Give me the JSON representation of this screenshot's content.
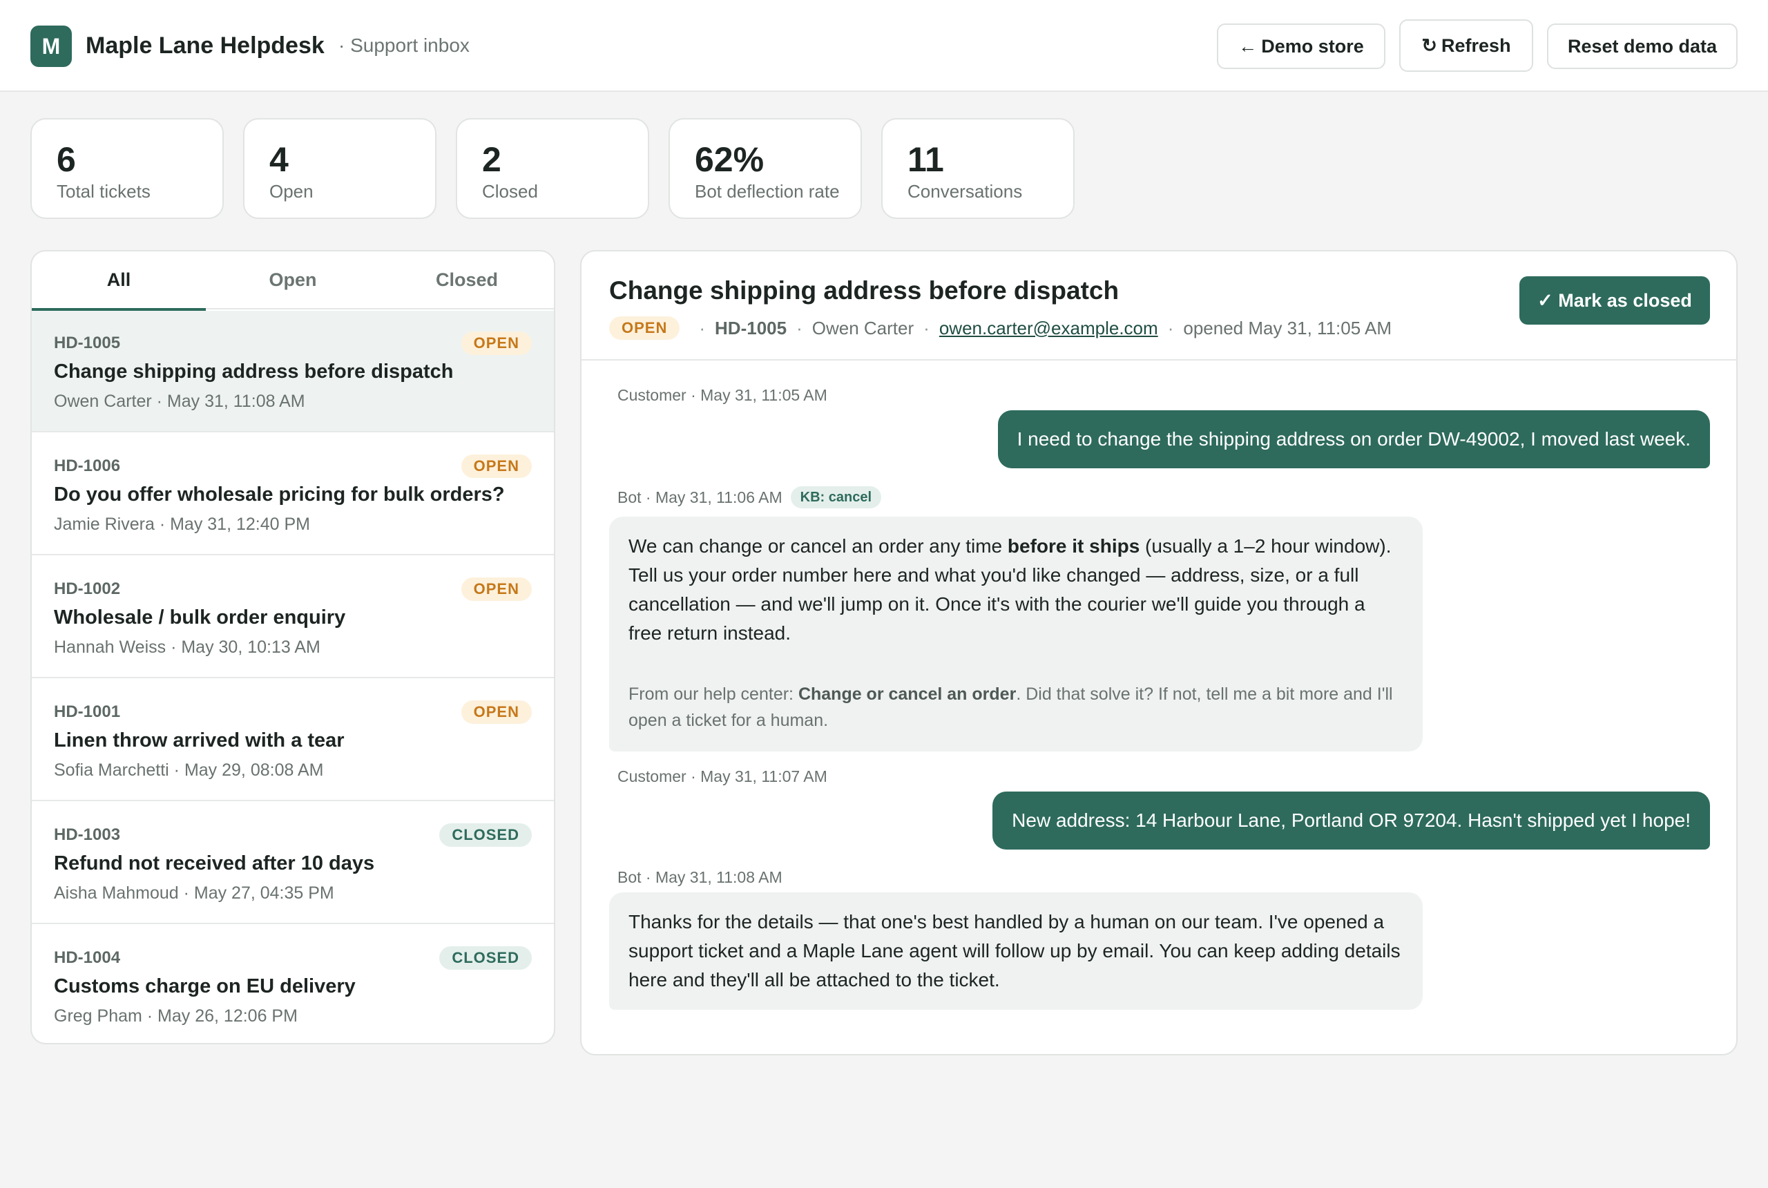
{
  "app": {
    "logo_letter": "M",
    "title": "Maple Lane Helpdesk",
    "subtitle": "· Support inbox"
  },
  "toolbar": {
    "demo_icon": "←",
    "demo_label": "Demo store",
    "refresh_icon": "↻",
    "refresh_label": "Refresh",
    "reset_label": "Reset demo data"
  },
  "stats": [
    {
      "value": "6",
      "label": "Total tickets"
    },
    {
      "value": "4",
      "label": "Open"
    },
    {
      "value": "2",
      "label": "Closed"
    },
    {
      "value": "62%",
      "label": "Bot deflection rate"
    },
    {
      "value": "11",
      "label": "Conversations"
    }
  ],
  "tabs": [
    {
      "label": "All",
      "active": true
    },
    {
      "label": "Open",
      "active": false
    },
    {
      "label": "Closed",
      "active": false
    }
  ],
  "tickets": [
    {
      "id": "HD-1005",
      "status": "OPEN",
      "title": "Change shipping address before dispatch",
      "meta": "Owen Carter · May 31, 11:08 AM",
      "selected": true
    },
    {
      "id": "HD-1006",
      "status": "OPEN",
      "title": "Do you offer wholesale pricing for bulk orders?",
      "meta": "Jamie Rivera · May 31, 12:40 PM",
      "selected": false
    },
    {
      "id": "HD-1002",
      "status": "OPEN",
      "title": "Wholesale / bulk order enquiry",
      "meta": "Hannah Weiss · May 30, 10:13 AM",
      "selected": false
    },
    {
      "id": "HD-1001",
      "status": "OPEN",
      "title": "Linen throw arrived with a tear",
      "meta": "Sofia Marchetti · May 29, 08:08 AM",
      "selected": false
    },
    {
      "id": "HD-1003",
      "status": "CLOSED",
      "title": "Refund not received after 10 days",
      "meta": "Aisha Mahmoud · May 27, 04:35 PM",
      "selected": false
    },
    {
      "id": "HD-1004",
      "status": "CLOSED",
      "title": "Customs charge on EU delivery",
      "meta": "Greg Pham · May 26, 12:06 PM",
      "selected": false
    }
  ],
  "detail": {
    "title": "Change shipping address before dispatch",
    "status": "OPEN",
    "id": "HD-1005",
    "customer": "Owen Carter",
    "email": "owen.carter@example.com",
    "opened": "opened May 31, 11:05 AM",
    "sep": "·",
    "close_button": "✓ Mark as closed",
    "messages": [
      {
        "meta": "Customer · May 31, 11:05 AM",
        "text": "I need to change the shipping address on order DW-49002, I moved last week."
      },
      {
        "meta": "Bot · May 31, 11:06 AM",
        "kb": "KB: cancel",
        "text_before": "We can change or cancel an order any time ",
        "text_bold": "before it ships",
        "text_after": " (usually a 1–2 hour window). Tell us your order number here and what you'd like changed — address, size, or a full cancellation — and we'll jump on it. Once it's with the courier we'll guide you through a free return instead.",
        "foot_before": "From our help center: ",
        "foot_bold": "Change or cancel an order",
        "foot_after": ". Did that solve it? If not, tell me a bit more and I'll open a ticket for a human."
      },
      {
        "meta": "Customer · May 31, 11:07 AM",
        "text": "New address: 14 Harbour Lane, Portland OR 97204. Hasn't shipped yet I hope!"
      },
      {
        "meta": "Bot · May 31, 11:08 AM",
        "text": "Thanks for the details — that one's best handled by a human on our team. I've opened a support ticket and a Maple Lane agent will follow up by email. You can keep adding details here and they'll all be attached to the ticket."
      }
    ]
  },
  "colors": {
    "accent": "#2e6b5c",
    "open_badge_bg": "#fdf1dc",
    "open_badge_fg": "#c6781a",
    "closed_badge_bg": "#e4efeb",
    "closed_badge_fg": "#2e6b5c"
  }
}
